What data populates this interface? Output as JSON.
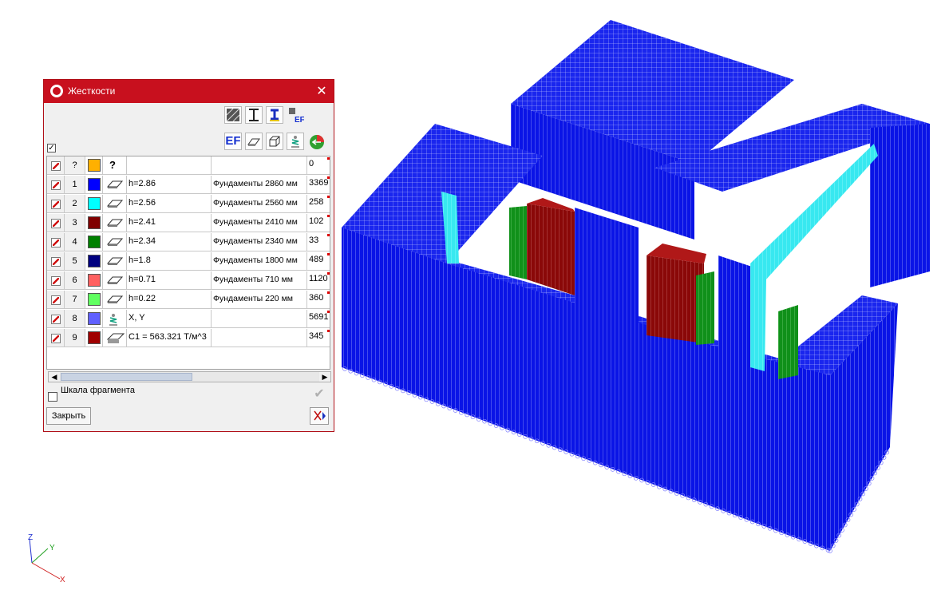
{
  "dialog": {
    "title": "Жесткости",
    "close_glyph": "✕",
    "select_all_checked": true,
    "toolbar_row1": [
      "hatch-section-icon",
      "i-beam-icon",
      "steel-section-icon",
      "ef-small-icon"
    ],
    "toolbar_row2": [
      "ef-icon",
      "plate-icon",
      "solid-icon",
      "spring-icon",
      "color-wheel-icon"
    ],
    "toolbar_ef_label": "EF",
    "table": {
      "rows": [
        {
          "num": "?",
          "color": "#ffb000",
          "icon": "question-icon",
          "param": "",
          "name": "",
          "count": "0",
          "checked": true
        },
        {
          "num": "1",
          "color": "#0000ff",
          "icon": "plate-icon",
          "param": "h=2.86",
          "name": "Фундаменты 2860 мм",
          "count": "3369",
          "checked": true
        },
        {
          "num": "2",
          "color": "#00ffff",
          "icon": "plate-icon",
          "param": "h=2.56",
          "name": "Фундаменты 2560 мм",
          "count": "258",
          "checked": true
        },
        {
          "num": "3",
          "color": "#800000",
          "icon": "plate-icon",
          "param": "h=2.41",
          "name": "Фундаменты 2410 мм",
          "count": "102",
          "checked": true
        },
        {
          "num": "4",
          "color": "#008000",
          "icon": "plate-icon",
          "param": "h=2.34",
          "name": "Фундаменты 2340 мм",
          "count": "33",
          "checked": true
        },
        {
          "num": "5",
          "color": "#000080",
          "icon": "plate-icon",
          "param": "h=1.8",
          "name": "Фундаменты 1800 мм",
          "count": "489",
          "checked": true
        },
        {
          "num": "6",
          "color": "#ff6060",
          "icon": "plate-icon",
          "param": "h=0.71",
          "name": "Фундаменты 710 мм",
          "count": "1120",
          "checked": true
        },
        {
          "num": "7",
          "color": "#60ff60",
          "icon": "plate-icon",
          "param": "h=0.22",
          "name": "Фундаменты 220 мм",
          "count": "360",
          "checked": true
        },
        {
          "num": "8",
          "color": "#6060ff",
          "icon": "spring-icon",
          "param": "X, Y",
          "name": "",
          "count": "5691",
          "checked": true
        },
        {
          "num": "9",
          "color": "#a00000",
          "icon": "soil-icon",
          "param": "C1 = 563.321 T/м^3",
          "name": "",
          "count": "345",
          "checked": true
        }
      ]
    },
    "scroll_left": "◀",
    "scroll_right": "▶",
    "scale_label": "Шкала фрагмента",
    "scale_checked": false,
    "apply_glyph": "✔",
    "close_button": "Закрыть"
  },
  "axes": {
    "x": "X",
    "y": "Y",
    "z": "Z"
  },
  "colors": {
    "title_bar": "#c8101e",
    "mesh_blue": "#0a14e6",
    "mesh_cyan": "#38e8f0",
    "mesh_red": "#8a0808",
    "mesh_green": "#10901a"
  }
}
